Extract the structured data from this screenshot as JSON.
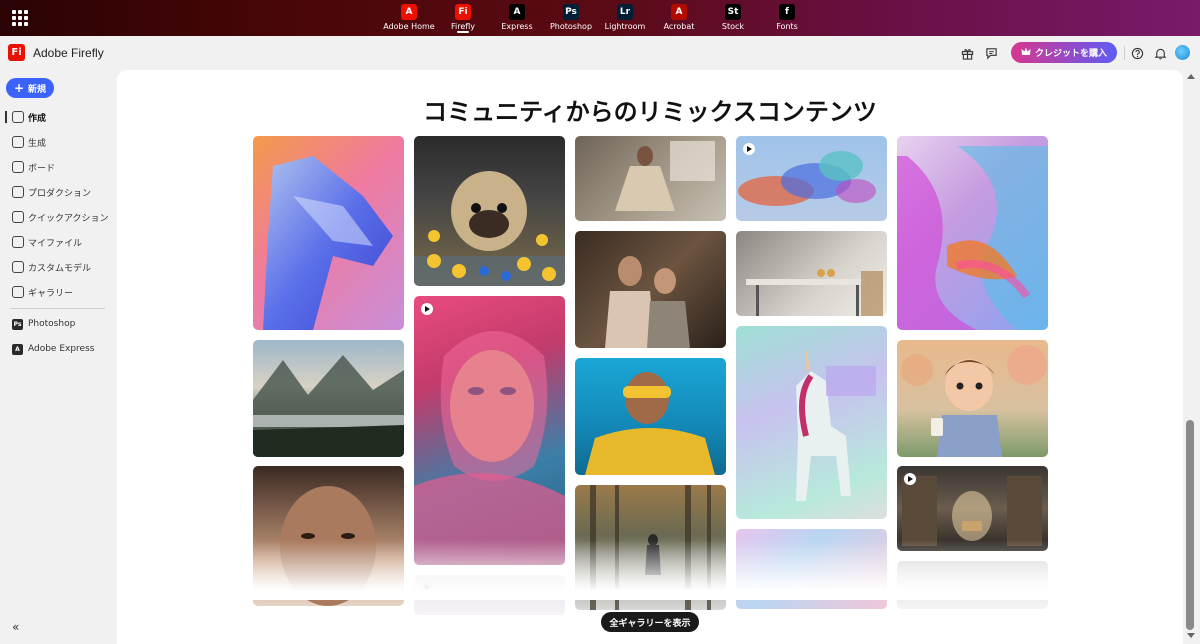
{
  "topbar": {
    "apps": [
      {
        "label": "Adobe Home",
        "glyph": "A",
        "color": "#eb1000",
        "active": false
      },
      {
        "label": "Firefly",
        "glyph": "Fi",
        "color": "#eb1000",
        "active": true
      },
      {
        "label": "Express",
        "glyph": "A",
        "color": "#000000",
        "active": false
      },
      {
        "label": "Photoshop",
        "glyph": "Ps",
        "color": "#001e36",
        "active": false
      },
      {
        "label": "Lightroom",
        "glyph": "Lr",
        "color": "#001e36",
        "active": false
      },
      {
        "label": "Acrobat",
        "glyph": "A",
        "color": "#b30b00",
        "active": false
      },
      {
        "label": "Stock",
        "glyph": "St",
        "color": "#000000",
        "active": false
      },
      {
        "label": "Fonts",
        "glyph": "f",
        "color": "#000000",
        "active": false
      }
    ]
  },
  "header": {
    "logo_glyph": "Fi",
    "title": "Adobe Firefly",
    "buy_credits": "クレジットを購入",
    "icons": [
      "gift-icon",
      "chat-icon",
      "help-icon",
      "bell-icon"
    ]
  },
  "sidebar": {
    "new_label": "新規",
    "items": [
      {
        "label": "作成",
        "active": true,
        "name": "sidebar-item-create"
      },
      {
        "label": "生成",
        "active": false,
        "name": "sidebar-item-generate"
      },
      {
        "label": "ボード",
        "active": false,
        "name": "sidebar-item-boards"
      },
      {
        "label": "プロダクション",
        "active": false,
        "name": "sidebar-item-production"
      },
      {
        "label": "クイックアクション",
        "active": false,
        "name": "sidebar-item-quick-actions"
      },
      {
        "label": "マイファイル",
        "active": false,
        "name": "sidebar-item-my-files"
      },
      {
        "label": "カスタムモデル",
        "active": false,
        "name": "sidebar-item-custom-models"
      },
      {
        "label": "ギャラリー",
        "active": false,
        "name": "sidebar-item-gallery"
      }
    ],
    "apps": [
      {
        "label": "Photoshop",
        "glyph": "Ps"
      },
      {
        "label": "Adobe Express",
        "glyph": "A"
      }
    ]
  },
  "main": {
    "title": "コミュニティからのリミックスコンテンツ",
    "show_all": "全ギャラリーを表示",
    "tiles": [
      {
        "name": "gallery-tile-crystal-cougar",
        "video": false
      },
      {
        "name": "gallery-tile-valley-landscape",
        "video": false
      },
      {
        "name": "gallery-tile-curly-hair-portrait",
        "video": false
      },
      {
        "name": "gallery-tile-pug-bath",
        "video": false
      },
      {
        "name": "gallery-tile-pink-scarf-portrait",
        "video": true
      },
      {
        "name": "gallery-tile-column2-bottom",
        "video": true
      },
      {
        "name": "gallery-tile-woman-dress",
        "video": false
      },
      {
        "name": "gallery-tile-mother-child",
        "video": false
      },
      {
        "name": "gallery-tile-yellow-sunglasses",
        "video": false
      },
      {
        "name": "gallery-tile-forest-figure",
        "video": false
      },
      {
        "name": "gallery-tile-colorful-smoke",
        "video": true
      },
      {
        "name": "gallery-tile-dining-table",
        "video": false
      },
      {
        "name": "gallery-tile-unicorn",
        "video": false
      },
      {
        "name": "gallery-tile-holographic-fabric",
        "video": false
      },
      {
        "name": "gallery-tile-abstract-glass",
        "video": false
      },
      {
        "name": "gallery-tile-3d-boy-coffee",
        "video": false
      },
      {
        "name": "gallery-tile-library",
        "video": true
      },
      {
        "name": "gallery-tile-column5-bottom",
        "video": false
      }
    ]
  },
  "colors": {
    "accent_blue": "#3b63fb",
    "firefly_red": "#eb1000"
  }
}
